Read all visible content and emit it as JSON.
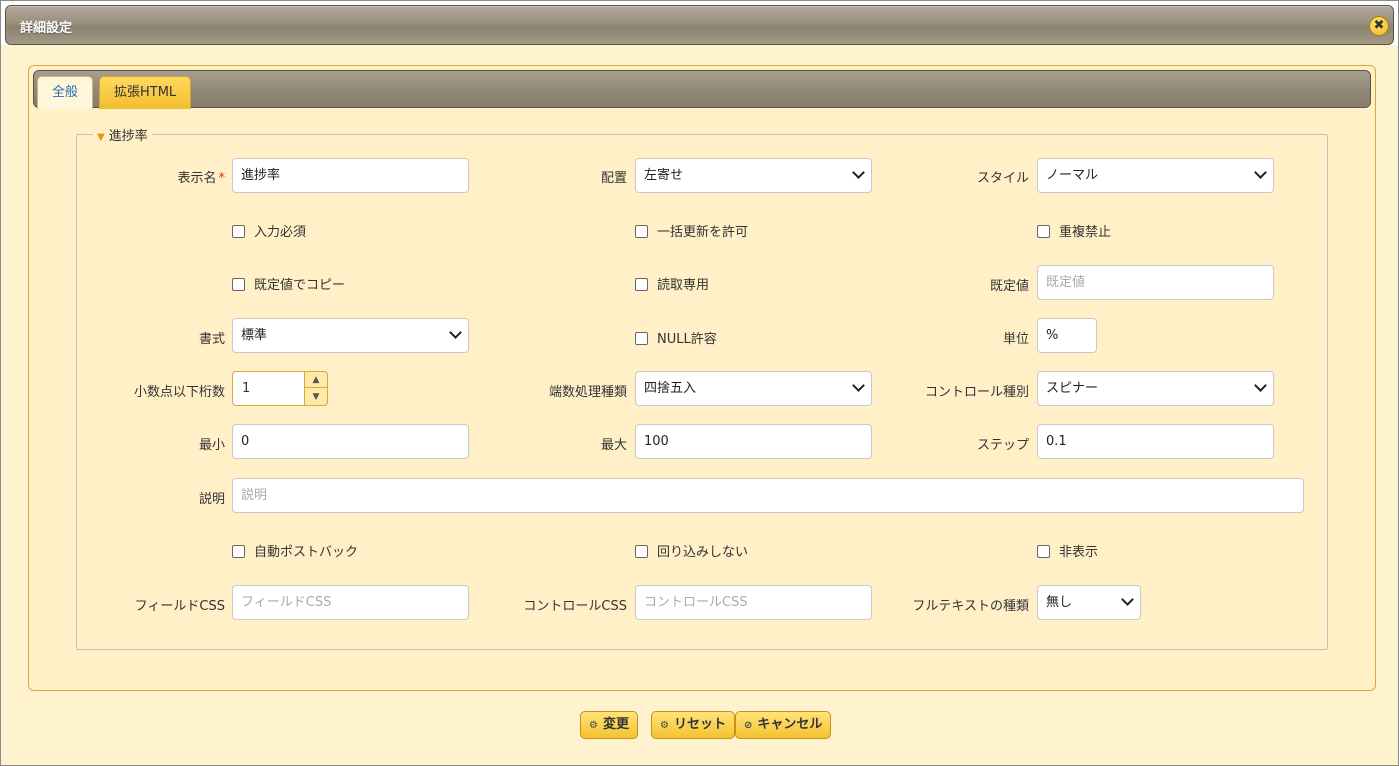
{
  "dialog": {
    "title": "詳細設定",
    "close_glyph": "✖"
  },
  "tabs": [
    {
      "label": "全般"
    },
    {
      "label": "拡張HTML"
    }
  ],
  "group": {
    "legend": "進捗率"
  },
  "form": {
    "display_name": {
      "label": "表示名",
      "required_mark": "*",
      "value": "進捗率"
    },
    "alignment": {
      "label": "配置",
      "value": "左寄せ"
    },
    "style": {
      "label": "スタイル",
      "value": "ノーマル"
    },
    "required_input": {
      "label": "入力必須"
    },
    "allow_bulk_update": {
      "label": "一括更新を許可"
    },
    "no_duplicates": {
      "label": "重複禁止"
    },
    "copy_with_default": {
      "label": "既定値でコピー"
    },
    "read_only": {
      "label": "読取専用"
    },
    "default_value": {
      "label": "既定値",
      "placeholder": "既定値"
    },
    "format": {
      "label": "書式",
      "value": "標準"
    },
    "allow_null": {
      "label": "NULL許容"
    },
    "unit": {
      "label": "単位",
      "value": "%"
    },
    "decimal_places": {
      "label": "小数点以下桁数",
      "value": "1"
    },
    "rounding_type": {
      "label": "端数処理種類",
      "value": "四捨五入"
    },
    "control_type": {
      "label": "コントロール種別",
      "value": "スピナー"
    },
    "min": {
      "label": "最小",
      "value": "0"
    },
    "max": {
      "label": "最大",
      "value": "100"
    },
    "step": {
      "label": "ステップ",
      "value": "0.1"
    },
    "description": {
      "label": "説明",
      "placeholder": "説明"
    },
    "auto_postback": {
      "label": "自動ポストバック"
    },
    "no_wrap": {
      "label": "回り込みしない"
    },
    "hidden": {
      "label": "非表示"
    },
    "field_css": {
      "label": "フィールドCSS",
      "placeholder": "フィールドCSS"
    },
    "control_css": {
      "label": "コントロールCSS",
      "placeholder": "コントロールCSS"
    },
    "fulltext_type": {
      "label": "フルテキストの種類",
      "value": "無し"
    }
  },
  "buttons": {
    "change": {
      "label": "変更",
      "icon": "⚙"
    },
    "reset": {
      "label": "リセット",
      "icon": "⚙"
    },
    "cancel": {
      "label": "キャンセル",
      "icon": "⊘"
    }
  },
  "colors": {
    "accent": "#f5c230",
    "panel": "#fff0c8",
    "titlebar": "#9a907e",
    "active_tab_text": "#1f6fb4"
  }
}
